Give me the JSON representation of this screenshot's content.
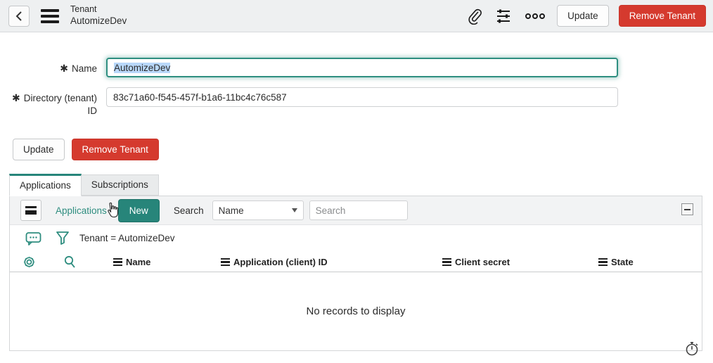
{
  "header": {
    "title_line1": "Tenant",
    "title_line2": "AutomizeDev",
    "update_label": "Update",
    "remove_label": "Remove Tenant"
  },
  "form": {
    "required_marker": "✱",
    "name_label": "Name",
    "name_value": "AutomizeDev",
    "directory_label_line1": "Directory (tenant)",
    "directory_label_line2": "ID",
    "directory_value": "83c71a60-f545-457f-b1a6-11bc4c76c587"
  },
  "actions": {
    "update_label": "Update",
    "remove_label": "Remove Tenant"
  },
  "tabs": [
    {
      "label": "Applications",
      "active": true
    },
    {
      "label": "Subscriptions",
      "active": false
    }
  ],
  "grid": {
    "title": "Applications",
    "new_button_label": "New",
    "search_label": "Search",
    "search_column_selected": "Name",
    "search_placeholder": "Search",
    "filter_text": "Tenant = AutomizeDev",
    "columns": [
      "Name",
      "Application (client) ID",
      "Client secret",
      "State"
    ],
    "empty_text": "No records to display"
  },
  "colors": {
    "accent": "#27857a",
    "danger": "#d53a2e",
    "selection": "#b9d8fa"
  }
}
